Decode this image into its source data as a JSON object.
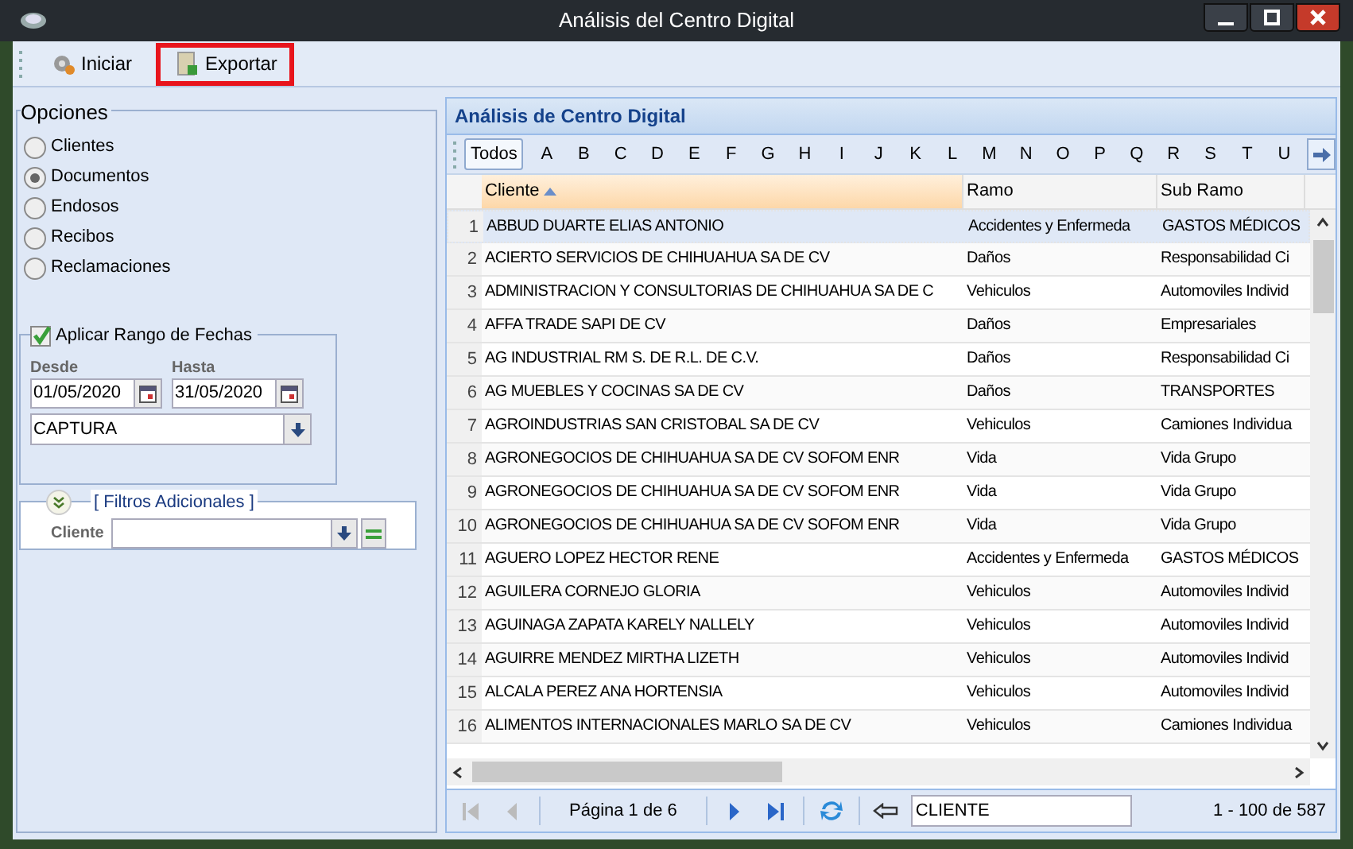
{
  "window": {
    "title": "Análisis del Centro Digital"
  },
  "toolbar": [
    {
      "label": "Iniciar",
      "highlighted": false
    },
    {
      "label": "Exportar",
      "highlighted": true
    }
  ],
  "options": {
    "title": "Opciones",
    "items": [
      {
        "label": "Clientes",
        "selected": false
      },
      {
        "label": "Documentos",
        "selected": true
      },
      {
        "label": "Endosos",
        "selected": false
      },
      {
        "label": "Recibos",
        "selected": false
      },
      {
        "label": "Reclamaciones",
        "selected": false
      }
    ]
  },
  "date_range": {
    "label": "Aplicar Rango de Fechas",
    "checked": true,
    "from_label": "Desde",
    "from": "01/05/2020",
    "to_label": "Hasta",
    "to": "31/05/2020",
    "date_type": "CAPTURA"
  },
  "filters": {
    "title": "[ Filtros Adicionales ]",
    "client_label": "Cliente"
  },
  "grid": {
    "title": "Análisis de Centro Digital",
    "letters": [
      {
        "label": "Todos",
        "selected": true
      },
      {
        "label": "A",
        "selected": false
      },
      {
        "label": "B",
        "selected": false
      },
      {
        "label": "C",
        "selected": false
      },
      {
        "label": "D",
        "selected": false
      },
      {
        "label": "E",
        "selected": false
      },
      {
        "label": "F",
        "selected": false
      },
      {
        "label": "G",
        "selected": false
      },
      {
        "label": "H",
        "selected": false
      },
      {
        "label": "I",
        "selected": false
      },
      {
        "label": "J",
        "selected": false
      },
      {
        "label": "K",
        "selected": false
      },
      {
        "label": "L",
        "selected": false
      },
      {
        "label": "M",
        "selected": false
      },
      {
        "label": "N",
        "selected": false
      },
      {
        "label": "O",
        "selected": false
      },
      {
        "label": "P",
        "selected": false
      },
      {
        "label": "Q",
        "selected": false
      },
      {
        "label": "R",
        "selected": false
      },
      {
        "label": "S",
        "selected": false
      },
      {
        "label": "T",
        "selected": false
      },
      {
        "label": "U",
        "selected": false
      }
    ],
    "columns": [
      {
        "label": "Cliente",
        "sorted": true
      },
      {
        "label": "Ramo",
        "sorted": false
      },
      {
        "label": "Sub Ramo",
        "sorted": false
      }
    ],
    "rows": [
      {
        "num": "1",
        "cells": [
          "ABBUD DUARTE ELIAS ANTONIO",
          "Accidentes y Enfermeda",
          "GASTOS MÉDICOS"
        ],
        "selected": true
      },
      {
        "num": "2",
        "cells": [
          "ACIERTO SERVICIOS DE CHIHUAHUA SA DE CV",
          "Daños",
          "Responsabilidad Ci"
        ],
        "selected": false
      },
      {
        "num": "3",
        "cells": [
          "ADMINISTRACION Y CONSULTORIAS DE CHIHUAHUA SA DE C",
          "Vehiculos",
          "Automoviles Individ"
        ],
        "selected": false
      },
      {
        "num": "4",
        "cells": [
          "AFFA TRADE SAPI DE CV",
          "Daños",
          "Empresariales"
        ],
        "selected": false
      },
      {
        "num": "5",
        "cells": [
          "AG INDUSTRIAL RM S. DE R.L. DE C.V.",
          "Daños",
          "Responsabilidad Ci"
        ],
        "selected": false
      },
      {
        "num": "6",
        "cells": [
          "AG MUEBLES Y COCINAS SA DE CV",
          "Daños",
          "TRANSPORTES"
        ],
        "selected": false
      },
      {
        "num": "7",
        "cells": [
          "AGROINDUSTRIAS SAN CRISTOBAL SA DE CV",
          "Vehiculos",
          "Camiones Individua"
        ],
        "selected": false
      },
      {
        "num": "8",
        "cells": [
          "AGRONEGOCIOS DE CHIHUAHUA SA DE CV SOFOM ENR",
          "Vida",
          "Vida Grupo"
        ],
        "selected": false
      },
      {
        "num": "9",
        "cells": [
          "AGRONEGOCIOS DE CHIHUAHUA SA DE CV SOFOM ENR",
          "Vida",
          "Vida Grupo"
        ],
        "selected": false
      },
      {
        "num": "10",
        "cells": [
          "AGRONEGOCIOS DE CHIHUAHUA SA DE CV SOFOM ENR",
          "Vida",
          "Vida Grupo"
        ],
        "selected": false
      },
      {
        "num": "11",
        "cells": [
          "AGUERO LOPEZ HECTOR RENE",
          "Accidentes y Enfermeda",
          "GASTOS MÉDICOS"
        ],
        "selected": false
      },
      {
        "num": "12",
        "cells": [
          "AGUILERA CORNEJO GLORIA",
          "Vehiculos",
          "Automoviles Individ"
        ],
        "selected": false
      },
      {
        "num": "13",
        "cells": [
          "AGUINAGA ZAPATA KARELY NALLELY",
          "Vehiculos",
          "Automoviles Individ"
        ],
        "selected": false
      },
      {
        "num": "14",
        "cells": [
          "AGUIRRE MENDEZ MIRTHA LIZETH",
          "Vehiculos",
          "Automoviles Individ"
        ],
        "selected": false
      },
      {
        "num": "15",
        "cells": [
          "ALCALA PEREZ ANA HORTENSIA",
          "Vehiculos",
          "Automoviles Individ"
        ],
        "selected": false
      },
      {
        "num": "16",
        "cells": [
          "ALIMENTOS INTERNACIONALES MARLO SA DE CV",
          "Vehiculos",
          "Camiones Individua"
        ],
        "selected": false
      }
    ]
  },
  "pager": {
    "page": "Página 1 de 6",
    "search": "CLIENTE",
    "range": "1 - 100 de 587"
  }
}
